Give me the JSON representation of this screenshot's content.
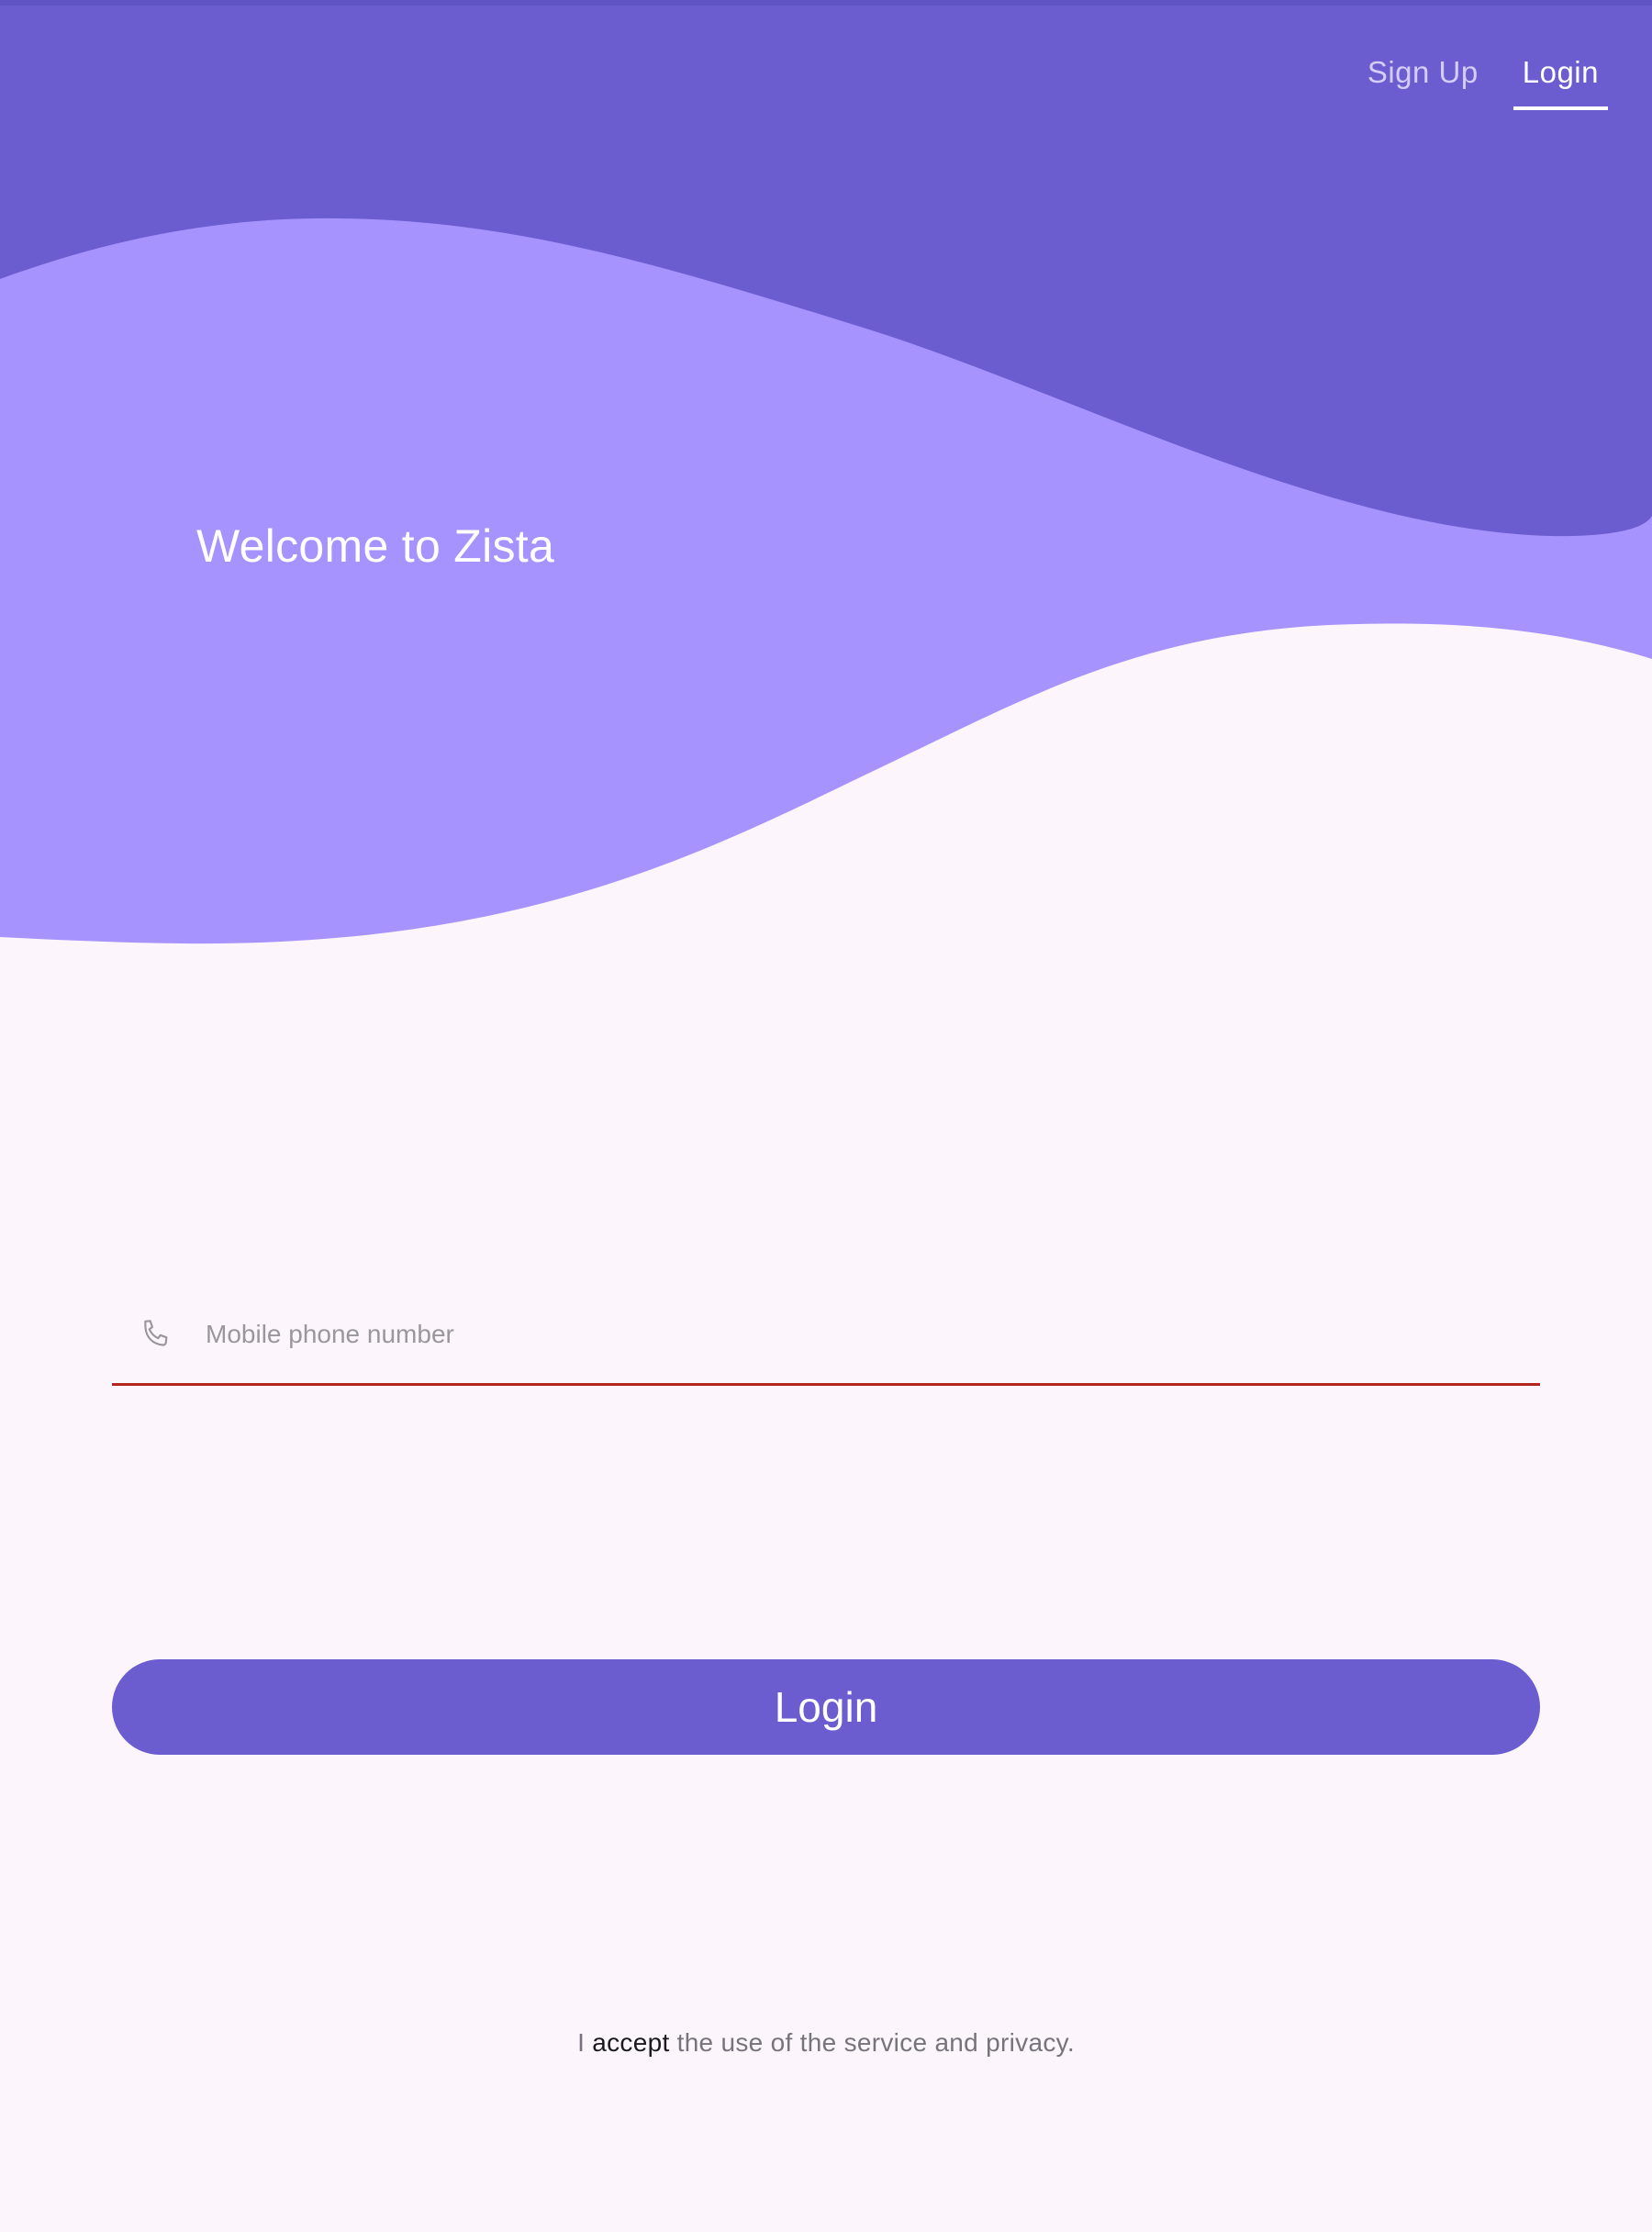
{
  "header": {
    "tabs": [
      {
        "label": "Sign Up",
        "active": false
      },
      {
        "label": "Login",
        "active": true
      }
    ]
  },
  "hero": {
    "welcome_text": "Welcome to Zista"
  },
  "form": {
    "phone_placeholder": "Mobile phone number",
    "phone_value": "",
    "phone_icon": "phone-icon",
    "login_button_label": "Login"
  },
  "footer": {
    "prefix": "I ",
    "accept_link": "accept",
    "suffix": " the use of the service and privacy."
  },
  "colors": {
    "primary_dark": "#6b5cd0",
    "primary_light": "#a793fd",
    "background": "#fcf5fc",
    "error_underline": "#b3261e"
  }
}
